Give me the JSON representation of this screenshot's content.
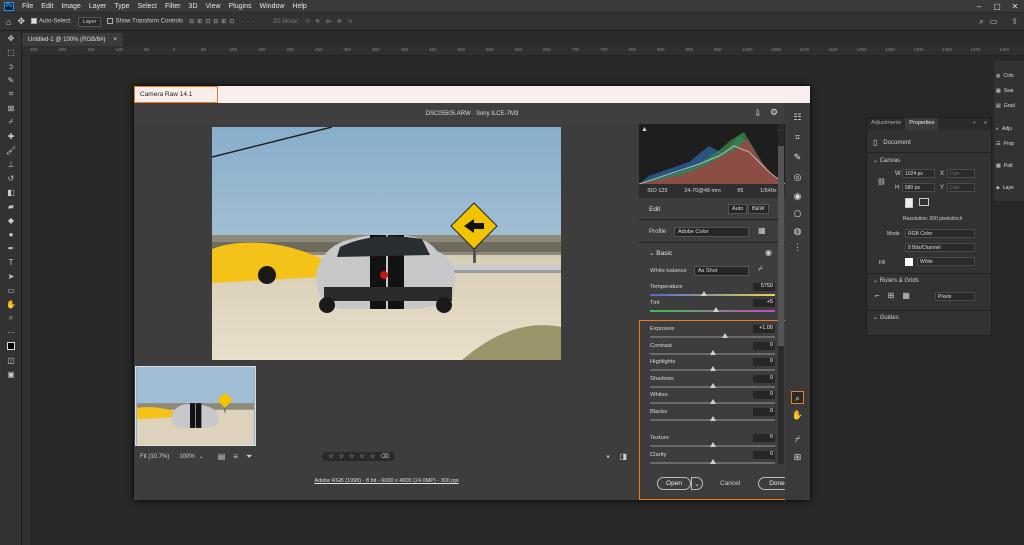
{
  "menu": [
    "File",
    "Edit",
    "Image",
    "Layer",
    "Type",
    "Select",
    "Filter",
    "3D",
    "View",
    "Plugins",
    "Window",
    "Help"
  ],
  "options": {
    "auto_select": "Auto-Select:",
    "layer_value": "Layer",
    "transform_controls": "Show Transform Controls",
    "mode3d": "3D Mode:"
  },
  "doc_tab": {
    "title": "Untitled-1 @ 100% (RGB/8#)",
    "close": "×"
  },
  "ruler_ticks": [
    "250",
    "200",
    "150",
    "100",
    "50",
    "0",
    "50",
    "100",
    "150",
    "200",
    "250",
    "300",
    "350",
    "400",
    "450",
    "500",
    "550",
    "600",
    "650",
    "700",
    "750",
    "800",
    "850",
    "900",
    "950",
    "1000",
    "1050",
    "1100",
    "1150",
    "1200",
    "1250",
    "1300",
    "1350",
    "1400",
    "1450"
  ],
  "camera_raw": {
    "title": "Camera Raw 14.1",
    "file": "DSC05505.ARW  ·  Sony ILCE-7M3",
    "zoom_fit": "Fit (10.7%)",
    "zoom_pct": "100%",
    "stars": [
      "☆",
      "☆",
      "☆",
      "☆",
      "☆"
    ],
    "footer": "Adobe RGB (1998) - 8 bit - 6000 x 4000 (24.0MP) - 300 ppi",
    "exif": [
      "ISO 125",
      "24-70@49 mm",
      "f/5",
      "1/640s"
    ],
    "edit_label": "Edit",
    "auto_btn": "Auto",
    "bw_btn": "B&W",
    "profile_label": "Profile",
    "profile_value": "Adobe Color",
    "basic_label": "Basic",
    "wb_label": "White balance",
    "wb_value": "As Shot",
    "temperature": {
      "label": "Temperature",
      "value": "5750",
      "pos": 0.43
    },
    "tint": {
      "label": "Tint",
      "value": "+5",
      "pos": 0.53
    },
    "sliders": [
      {
        "label": "Exposure",
        "value": "+1.00",
        "pos": 0.6
      },
      {
        "label": "Contrast",
        "value": "0",
        "pos": 0.5
      },
      {
        "label": "Highlights",
        "value": "0",
        "pos": 0.5
      },
      {
        "label": "Shadows",
        "value": "0",
        "pos": 0.5
      },
      {
        "label": "Whites",
        "value": "0",
        "pos": 0.5
      },
      {
        "label": "Blacks",
        "value": "0",
        "pos": 0.5
      }
    ],
    "sliders2": [
      {
        "label": "Texture",
        "value": "0",
        "pos": 0.5
      },
      {
        "label": "Clarity",
        "value": "0",
        "pos": 0.5
      }
    ],
    "buttons": {
      "open": "Open",
      "cancel": "Cancel",
      "done": "Done"
    }
  },
  "properties": {
    "tabs": [
      "Adjustments",
      "Properties"
    ],
    "document": "Document",
    "canvas_label": "Canvas",
    "w_label": "W",
    "w_value": "1024 px",
    "h_label": "H",
    "h_value": "680 px",
    "x_label": "X",
    "x_placeholder": "0 px",
    "y_label": "Y",
    "y_placeholder": "0 px",
    "resolution": "Resolution: 300 pixels/inch",
    "mode_label": "Mode",
    "mode_value": "RGB Color",
    "bits_value": "8 Bits/Channel",
    "fill_label": "Fill",
    "fill_value": "White",
    "rulers_label": "Rulers & Grids",
    "units_value": "Pixels",
    "guides_label": "Guides"
  },
  "dock": [
    "Colo",
    "Swa",
    "Grad",
    "Adju",
    "Prop",
    "Patt",
    "Laye"
  ],
  "colors": {
    "accent_orange": "#ee7c1d",
    "title_bg": "#f8eeee"
  }
}
